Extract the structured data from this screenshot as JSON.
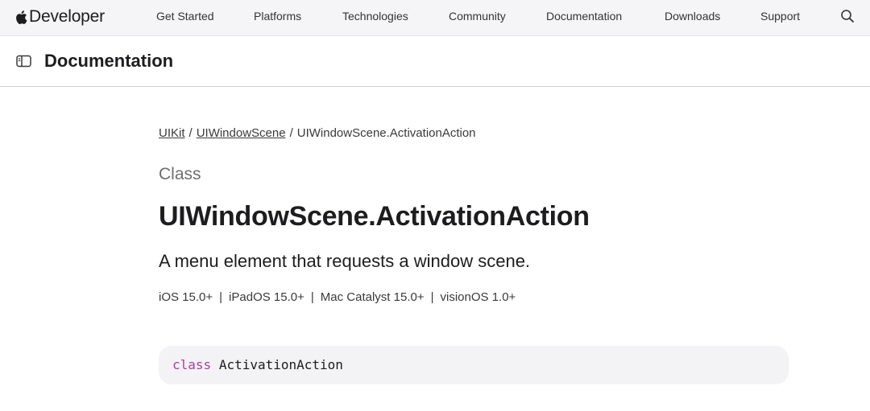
{
  "global_nav": {
    "brand": "Developer",
    "links": [
      "Get Started",
      "Platforms",
      "Technologies",
      "Community",
      "Documentation",
      "Downloads",
      "Support"
    ],
    "search_icon": "search-icon"
  },
  "doc_header": {
    "sidebar_icon": "sidebar-toggle-icon",
    "title": "Documentation"
  },
  "breadcrumb": {
    "items": [
      "UIKit",
      "UIWindowScene",
      "UIWindowScene.ActivationAction"
    ],
    "separator": "/"
  },
  "symbol": {
    "kind": "Class",
    "title": "UIWindowScene.ActivationAction",
    "abstract": "A menu element that requests a window scene.",
    "platforms": [
      "iOS 15.0+",
      "iPadOS 15.0+",
      "Mac Catalyst 15.0+",
      "visionOS 1.0+"
    ],
    "platform_separator": "|"
  },
  "declaration": {
    "keyword": "class",
    "name": "ActivationAction"
  },
  "colors": {
    "keyword": "#ad3da4",
    "nav_background": "#f5f5f7",
    "code_background": "#f3f3f5"
  }
}
